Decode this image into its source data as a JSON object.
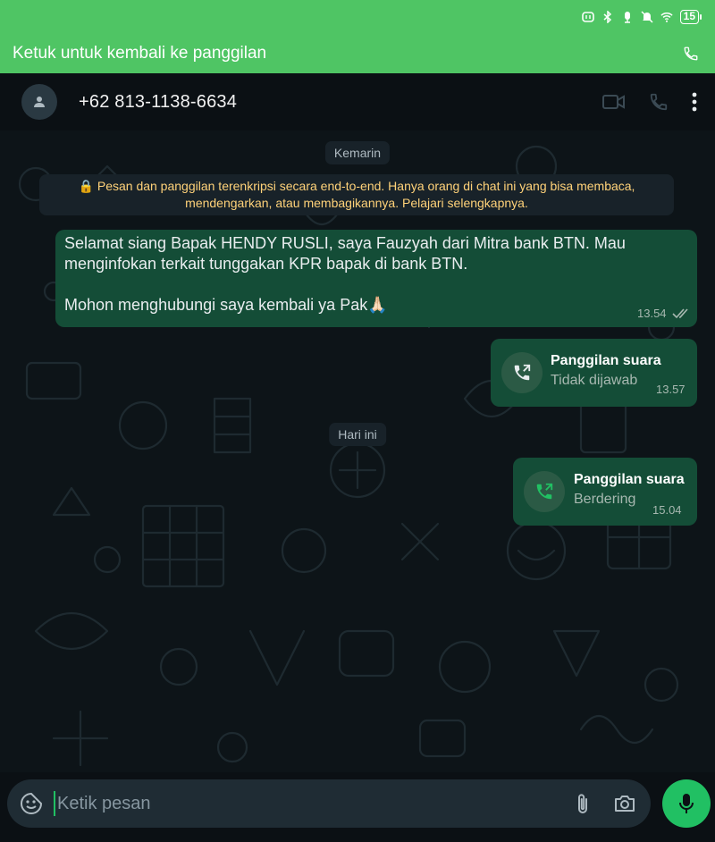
{
  "status_bar": {
    "battery_level": "15",
    "icons": [
      "nfc-icon",
      "bluetooth-icon",
      "vibrate-icon",
      "mute-icon",
      "wifi-icon",
      "battery-icon"
    ]
  },
  "return_banner": {
    "label": "Ketuk untuk kembali ke panggilan"
  },
  "header": {
    "contact_name": "+62 813-1138-6634"
  },
  "chat": {
    "day_yesterday": "Kemarin",
    "encryption_notice": "🔒 Pesan dan panggilan terenkripsi secara end-to-end. Hanya orang di chat ini yang bisa membaca, mendengarkan, atau membagikannya. Pelajari selengkapnya.",
    "message_1": {
      "text": "Selamat siang Bapak HENDY RUSLI, saya Fauzyah dari Mitra bank BTN. Mau menginfokan terkait tunggakan KPR bapak di bank BTN.\n\nMohon menghubungi saya kembali ya Pak🙏🏻",
      "time": "13.54"
    },
    "call_1": {
      "title": "Panggilan suara",
      "status": "Tidak dijawab",
      "time": "13.57"
    },
    "day_today": "Hari ini",
    "call_2": {
      "title": "Panggilan suara",
      "status": "Berdering",
      "time": "15.04"
    }
  },
  "composer": {
    "placeholder": "Ketik pesan"
  },
  "colors": {
    "accent": "#4fc564",
    "bubble_out": "#144d37",
    "mic": "#21c063",
    "notice_text": "#ffd279"
  }
}
